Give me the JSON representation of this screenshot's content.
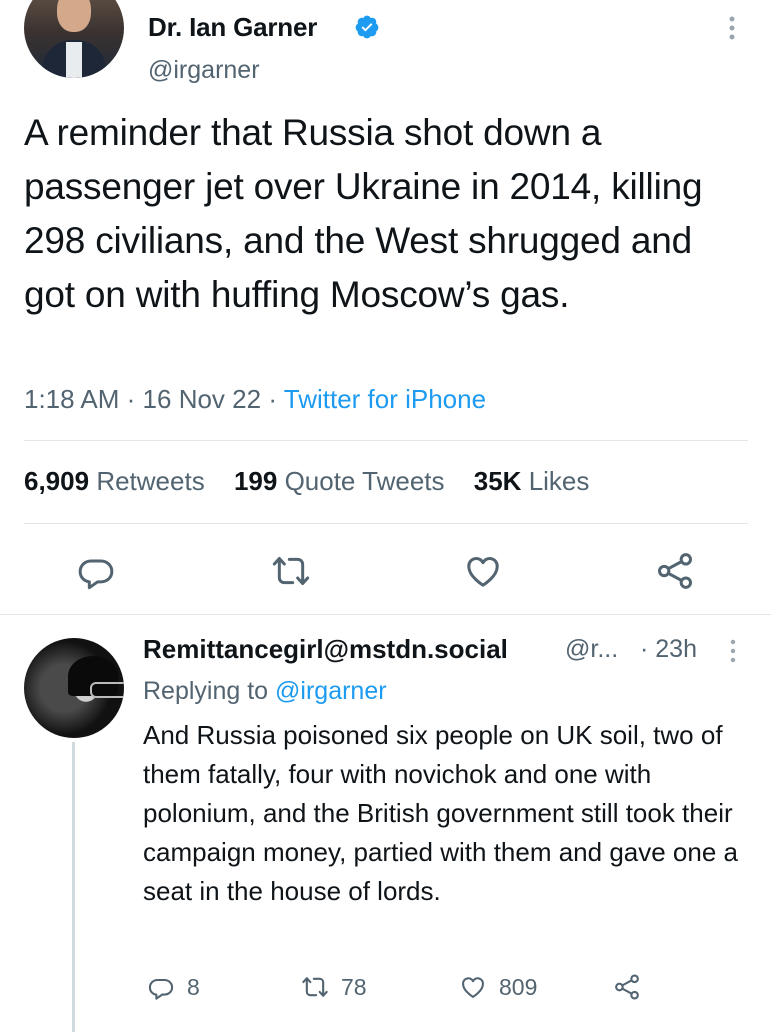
{
  "tweet": {
    "display_name": "Dr. Ian Garner",
    "handle": "@irgarner",
    "verified_icon": "verified-badge-icon",
    "text": "A reminder that Russia shot down a passenger jet over Ukraine in 2014, killing 298 civilians, and the West shrugged and got on with huffing Moscow’s gas.",
    "time": "1:18 AM",
    "date": "16 Nov 22",
    "source": "Twitter for iPhone",
    "separator": "·",
    "stats": {
      "retweets_count": "6,909",
      "retweets_label": "Retweets",
      "quotes_count": "199",
      "quotes_label": "Quote Tweets",
      "likes_count": "35K",
      "likes_label": "Likes"
    },
    "actions": [
      "reply-icon",
      "retweet-icon",
      "like-icon",
      "share-icon"
    ]
  },
  "reply": {
    "display_name": "Remittancegirl@mstdn.social",
    "handle": "@r...",
    "time": "· 23h",
    "replying_prefix": "Replying to",
    "replying_to": "@irgarner",
    "text": "And Russia poisoned six people on UK soil, two of them fatally, four with novichok and one with polonium, and the British government still took their campaign money, partied with them and gave one a seat in the house of lords.",
    "replies": "8",
    "retweets": "78",
    "likes": "809"
  },
  "colors": {
    "text": "#0f1419",
    "secondary": "#536471",
    "link": "#1d9bf0",
    "divider": "#e1e6ea"
  }
}
